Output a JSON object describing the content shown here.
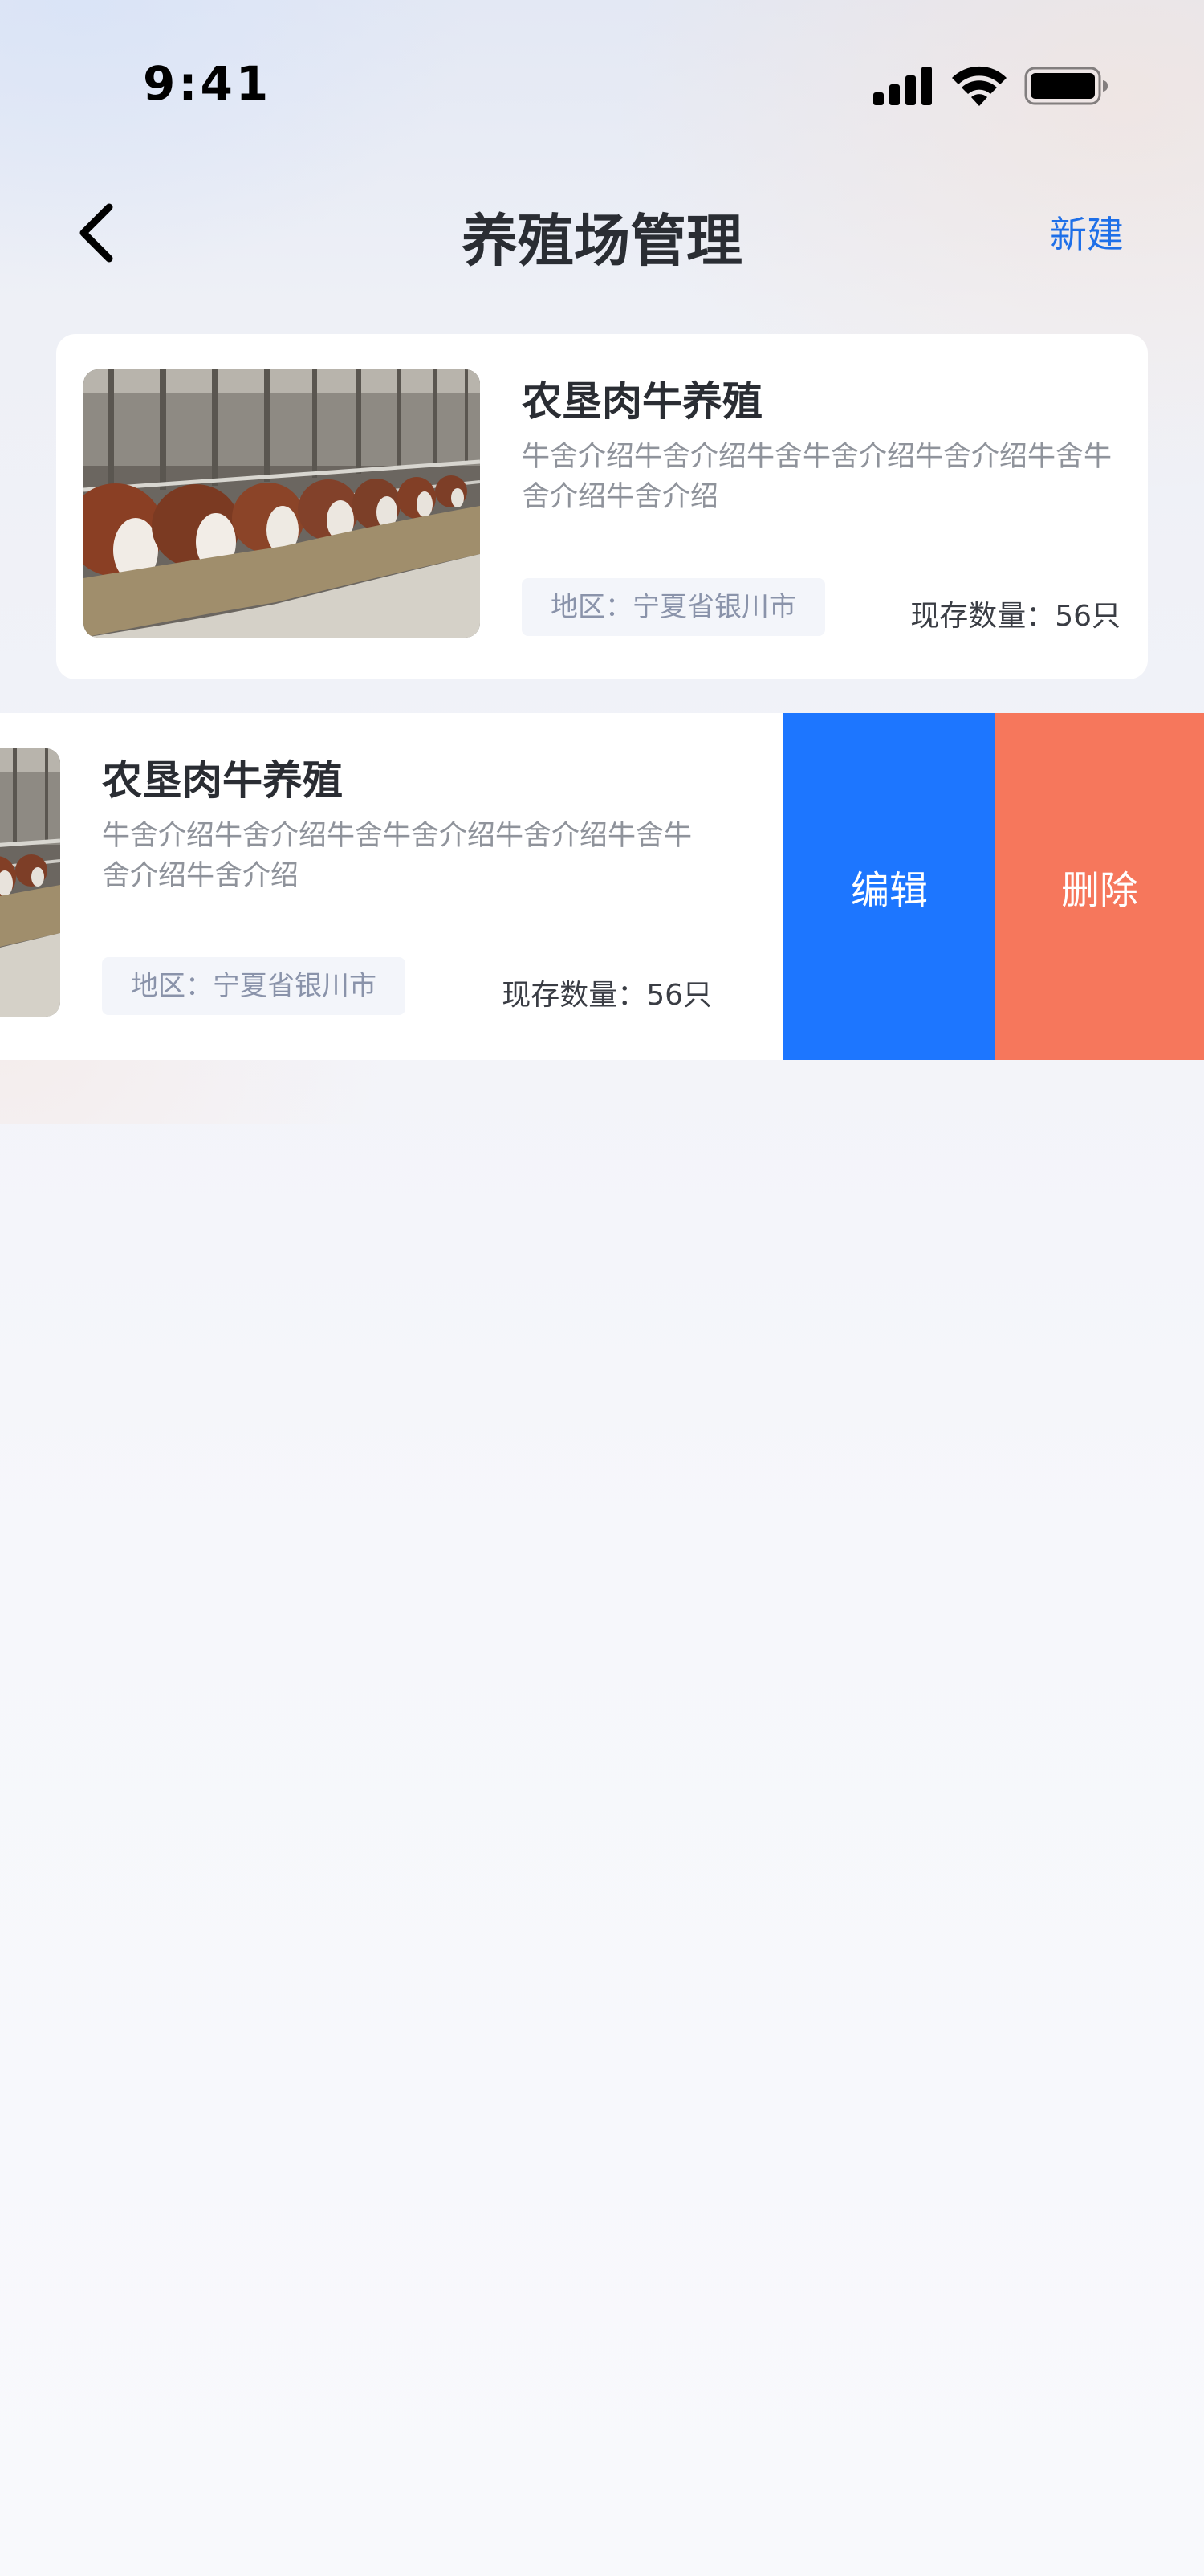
{
  "status_bar": {
    "time": "9:41",
    "icons": [
      "cellular-signal-icon",
      "wifi-icon",
      "battery-icon"
    ]
  },
  "nav": {
    "back_icon": "chevron-left-icon",
    "title": "养殖场管理",
    "new_label": "新建"
  },
  "farms": [
    {
      "name": "农垦肉牛养殖",
      "description": "牛舍介绍牛舍介绍牛舍牛舍介绍牛舍介绍牛舍牛舍介绍牛舍介绍",
      "region": "地区：宁夏省银川市",
      "stock": "现存数量：56只",
      "image": "cattle-barn-photo"
    },
    {
      "name": "农垦肉牛养殖",
      "description": "牛舍介绍牛舍介绍牛舍牛舍介绍牛舍介绍牛舍牛舍介绍牛舍介绍",
      "region": "地区：宁夏省银川市",
      "stock": "现存数量：56只",
      "image": "cattle-barn-photo",
      "swiped": true
    }
  ],
  "swipe_actions": {
    "edit_label": "编辑",
    "delete_label": "删除"
  },
  "colors": {
    "accent": "#1e6fe8",
    "edit": "#1d76ff",
    "delete": "#f6775c",
    "title": "#2a2d33",
    "muted": "#8f939b"
  }
}
